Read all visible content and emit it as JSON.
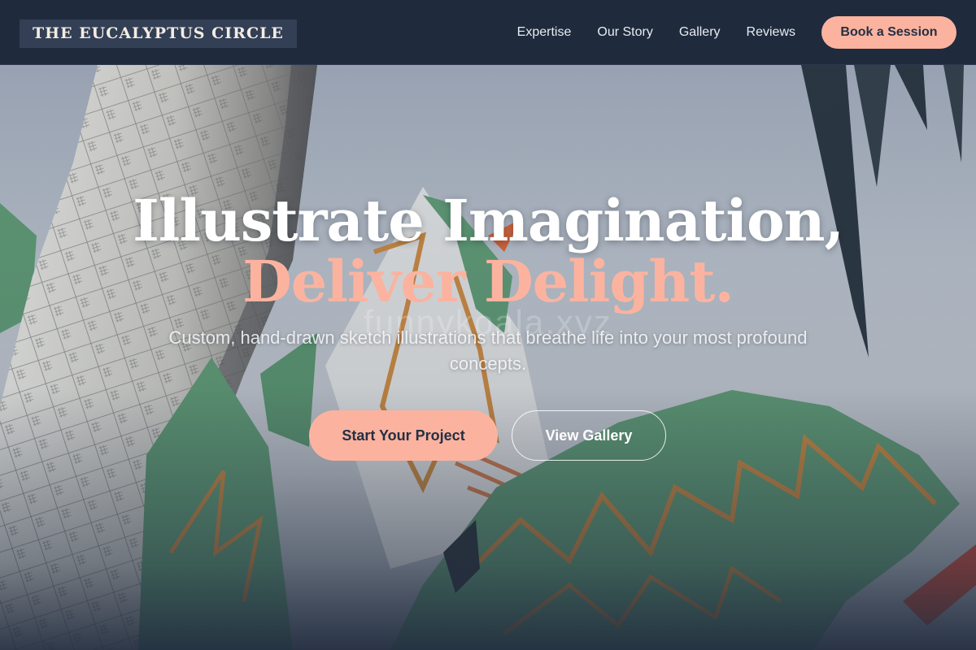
{
  "brand": {
    "name": "THE EUCALYPTUS CIRCLE"
  },
  "nav": {
    "links": [
      "Expertise",
      "Our Story",
      "Gallery",
      "Reviews"
    ],
    "cta_label": "Book a Session"
  },
  "hero": {
    "headline_line1": "Illustrate Imagination,",
    "headline_line2": "Deliver Delight.",
    "subtitle": "Custom, hand-drawn sketch illustrations that breathe life into your most profound concepts.",
    "primary_cta": "Start Your Project",
    "secondary_cta": "View Gallery",
    "watermark": "funnykoala.xyz",
    "background_image": "sketch-illustration-tower-leaves"
  },
  "colors": {
    "navy": "#1f2a3c",
    "accent": "#fbb39f",
    "leaf_green": "#5f9a75",
    "leaf_orange": "#c98942"
  }
}
